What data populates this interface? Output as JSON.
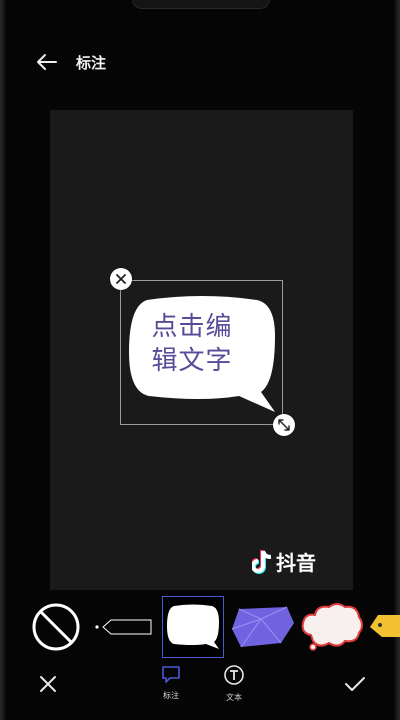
{
  "header": {
    "title": "标注",
    "back_icon": "arrow-left-icon"
  },
  "canvas": {
    "bubble_text_line1": "点击编",
    "bubble_text_line2": "辑文字",
    "bubble_text_color": "#5a4a9a",
    "watermark_text": "抖音",
    "watermark_icon": "tiktok-note-icon"
  },
  "stickers": [
    {
      "name": "none",
      "icon": "prohibited-icon",
      "selected": false
    },
    {
      "name": "arrow-tag",
      "icon": "arrow-tag-sticker",
      "selected": false
    },
    {
      "name": "speech-bubble",
      "icon": "speech-bubble-sticker",
      "selected": true
    },
    {
      "name": "purple-gem",
      "icon": "gem-sticker",
      "selected": false
    },
    {
      "name": "cloud-bubble",
      "icon": "cloud-sticker",
      "selected": false
    },
    {
      "name": "yellow-partial",
      "icon": "yellow-sticker",
      "selected": false
    }
  ],
  "tabs": [
    {
      "label": "标注",
      "icon": "annotate-icon",
      "active": true
    },
    {
      "label": "文本",
      "icon": "text-icon",
      "active": false
    }
  ],
  "accent_color": "#4a59d6"
}
